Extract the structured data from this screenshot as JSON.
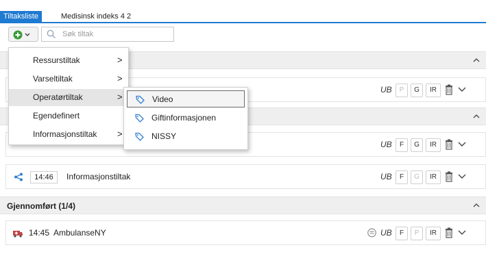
{
  "tabs": [
    {
      "label": "Tiltaksliste"
    },
    {
      "label": "Medisinsk indeks 4 2"
    }
  ],
  "toolbar": {
    "add_icon": "plus-circle-icon",
    "search_placeholder": "Søk tiltak"
  },
  "menu": {
    "items": [
      {
        "label": "Ressurstiltak",
        "arrow": ">"
      },
      {
        "label": "Varseltiltak",
        "arrow": ">"
      },
      {
        "label": "Operatørtiltak",
        "arrow": ">"
      },
      {
        "label": "Egendefinert",
        "arrow": ""
      },
      {
        "label": "Informasjonstiltak",
        "arrow": ">"
      }
    ]
  },
  "submenu": {
    "items": [
      {
        "label": "Video"
      },
      {
        "label": "Giftinformasjonen"
      },
      {
        "label": "NISSY"
      }
    ]
  },
  "rows": {
    "row1": {
      "ub": "UB",
      "b1": "P",
      "b2": "G",
      "b3": "IR"
    },
    "row2": {
      "ub": "UB",
      "b1": "F",
      "b2": "G",
      "b3": "IR"
    },
    "row3": {
      "time": "14:46",
      "label": "Informasjonstiltak",
      "ub": "UB",
      "b1": "F",
      "b2": "G",
      "b3": "IR"
    },
    "row4": {
      "time": "14:45",
      "label": "AmbulanseNY",
      "ub": "UB",
      "b1": "F",
      "b2": "P",
      "b3": "IR"
    }
  },
  "sections": {
    "completed_title": "Gjennomført (1/4)"
  },
  "colors": {
    "accent": "#1f7ad1",
    "share_icon": "#2e7fd4",
    "ambulance_icon": "#c44545"
  }
}
